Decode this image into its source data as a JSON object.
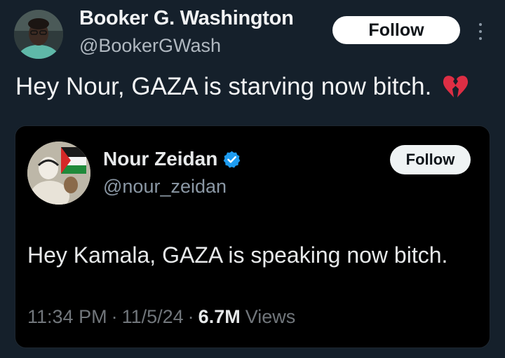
{
  "outer_tweet": {
    "author_name": "Booker G. Washington",
    "handle": "@BookerGWash",
    "follow_label": "Follow",
    "text": "Hey Nour, GAZA is starving now bitch.",
    "emoji_icon": "broken-heart-icon"
  },
  "quoted_tweet": {
    "author_name": "Nour Zeidan",
    "verified": true,
    "handle": "@nour_zeidan",
    "follow_label": "Follow",
    "text": "Hey Kamala, GAZA is speaking now bitch.",
    "time": "11:34 PM",
    "date": "11/5/24",
    "separator": "·",
    "views_count": "6.7M",
    "views_label": "Views"
  },
  "colors": {
    "background": "#15202b",
    "card_background": "#000000",
    "verified_blue": "#1d9bf0",
    "muted_text": "#71767b"
  }
}
